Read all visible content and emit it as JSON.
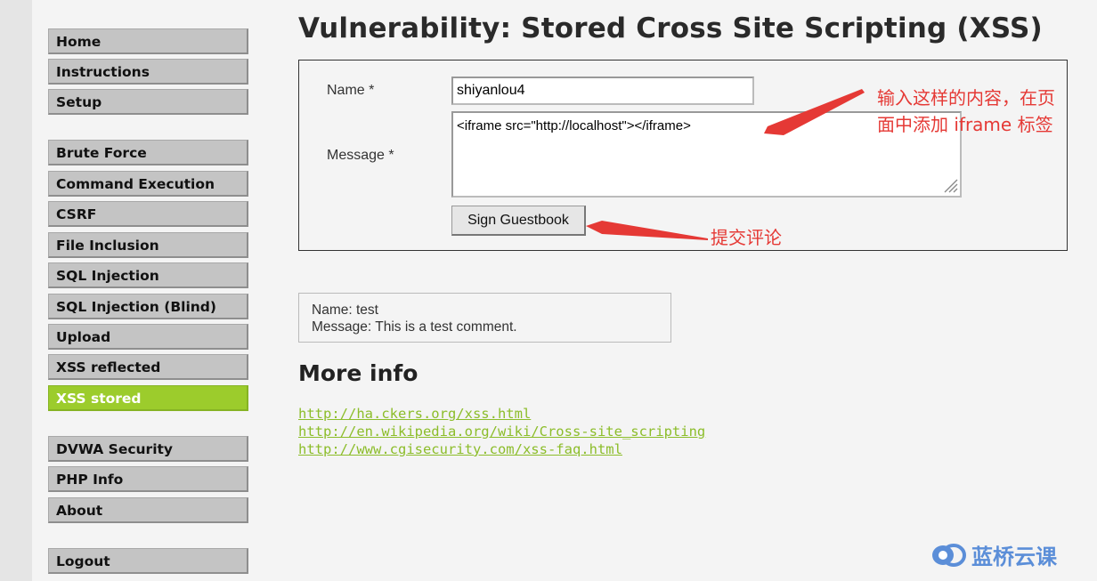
{
  "sidebar": {
    "group1": [
      "Home",
      "Instructions",
      "Setup"
    ],
    "group2": [
      "Brute Force",
      "Command Execution",
      "CSRF",
      "File Inclusion",
      "SQL Injection",
      "SQL Injection (Blind)",
      "Upload",
      "XSS reflected",
      "XSS stored"
    ],
    "group3": [
      "DVWA Security",
      "PHP Info",
      "About"
    ],
    "group4": [
      "Logout"
    ],
    "active": "XSS stored"
  },
  "page": {
    "title": "Vulnerability: Stored Cross Site Scripting (XSS)"
  },
  "form": {
    "name_label": "Name *",
    "name_value": "shiyanlou4",
    "message_label": "Message *",
    "message_value": "<iframe src=\"http://localhost\"></iframe>",
    "submit_label": "Sign Guestbook"
  },
  "comment": {
    "name_line": "Name: test",
    "message_line": "Message: This is a test comment."
  },
  "more_info": {
    "heading": "More info",
    "links": [
      "http://ha.ckers.org/xss.html",
      "http://en.wikipedia.org/wiki/Cross-site_scripting",
      "http://www.cgisecurity.com/xss-faq.html"
    ]
  },
  "annotations": {
    "input_note_line1": "输入这样的内容，在页",
    "input_note_line2": "面中添加 iframe 标签",
    "submit_note": "提交评论"
  },
  "watermark": {
    "text": "蓝桥云课"
  },
  "colors": {
    "accent_green": "#9ccc2c",
    "link_green": "#8cbd2a",
    "annotation_red": "#e53935",
    "watermark_blue": "#5b8ed8"
  }
}
